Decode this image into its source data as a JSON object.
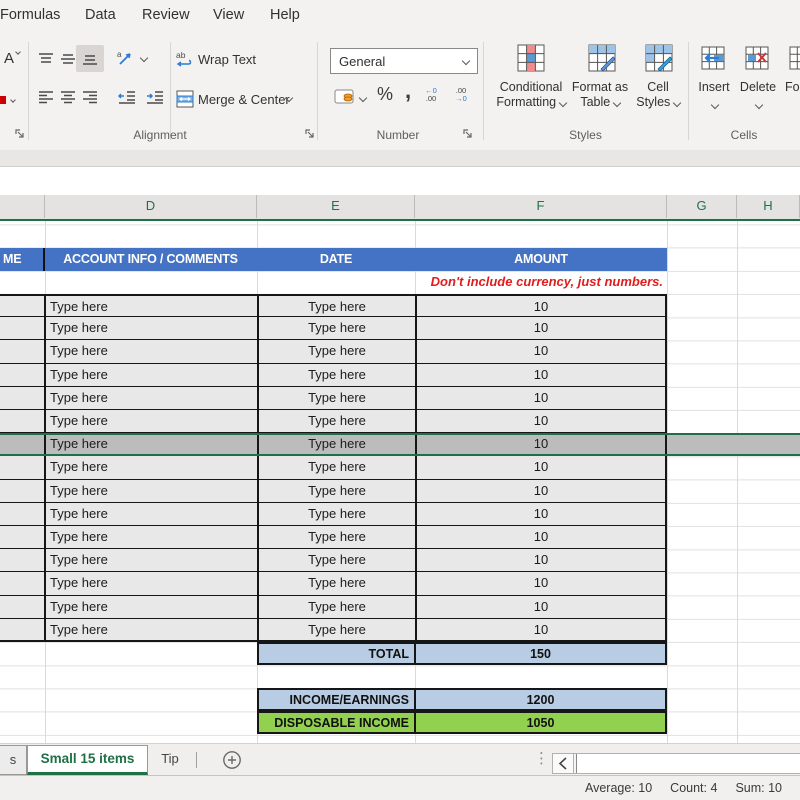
{
  "menu": {
    "items": [
      "Formulas",
      "Data",
      "Review",
      "View",
      "Help"
    ]
  },
  "ribbon": {
    "font_fragment": "A",
    "alignment": {
      "wrap_text": "Wrap Text",
      "merge_center": "Merge & Center",
      "label": "Alignment"
    },
    "number": {
      "format": "General",
      "label": "Number"
    },
    "styles": {
      "label": "Styles",
      "buttons": [
        [
          "Conditional",
          "Formatting"
        ],
        [
          "Format as",
          "Table"
        ],
        [
          "Cell",
          "Styles"
        ]
      ]
    },
    "cells": {
      "label": "Cells",
      "buttons": [
        "Insert",
        "Delete",
        "Fo"
      ]
    }
  },
  "sheet": {
    "column_letters": [
      "D",
      "E",
      "F",
      "G",
      "H"
    ],
    "header": {
      "fragment": "ME",
      "account": "ACCOUNT INFO / COMMENTS",
      "date": "DATE",
      "amount": "AMOUNT"
    },
    "note": "Don't include currency, just numbers.",
    "row_template": {
      "account": "Type here",
      "date": "Type here",
      "amount": "10"
    },
    "row_count": 15,
    "selected_row": 7,
    "total": {
      "label": "TOTAL",
      "value": "150"
    },
    "income": {
      "label": "INCOME/EARNINGS",
      "value": "1200"
    },
    "disposable": {
      "label": "DISPOSABLE INCOME",
      "value": "1050"
    }
  },
  "tabs": {
    "fragment": "s",
    "active": "Small 15 items",
    "second": "Tip"
  },
  "status": {
    "average": "Average: 10",
    "count": "Count: 4",
    "sum": "Sum: 10"
  },
  "colors": {
    "header_blue": "#4472c4",
    "light_blue": "#b8cce4",
    "green_cell": "#92d050",
    "selection_green": "#1e7145",
    "note_red": "#e21c1c",
    "tab_green": "#217346"
  }
}
